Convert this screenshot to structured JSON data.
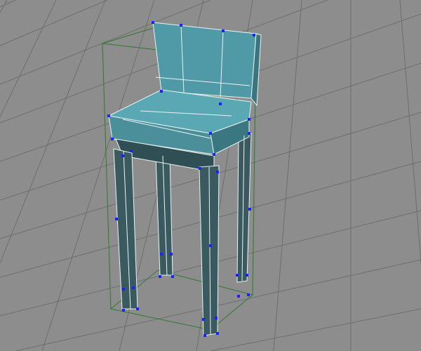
{
  "viewport": {
    "background_color": "#8d8d8d",
    "grid_color": "#6e6e6e",
    "model_color": "#4f9aa6",
    "model_dark_color": "#2f4f55",
    "wire_color": "#e8f4f4",
    "vertex_color": "#1a22ff",
    "bbox_color": "#2f7a2f"
  }
}
